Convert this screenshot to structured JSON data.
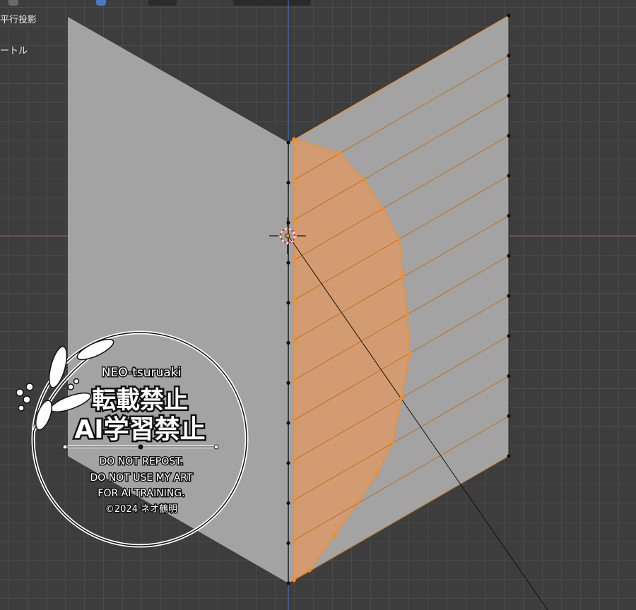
{
  "overlay": {
    "projection_label": "平行投影",
    "unit_label": "ートル"
  },
  "watermark": {
    "name": "NEO-tsuruaki",
    "line_jp_1": "転載禁止",
    "line_jp_2": "AI学習禁止",
    "line_en_1": "DO NOT REPOST.",
    "line_en_2": "DO NOT USE MY ART",
    "line_en_3": "FOR AI TRAINING.",
    "copyright": "©2024 ネオ鶴明"
  },
  "colors": {
    "grid_bg": "#3d3d3d",
    "grid_line": "#4a4a4a",
    "mesh_face": "#a3a3a3",
    "selected_face": "#d79a6c",
    "selected_edge": "#ff8a1c",
    "vertex": "#111111",
    "x_axis": "#b34a4a",
    "z_axis": "#3f6fb8"
  },
  "icons": {
    "cursor": "3d-cursor-icon",
    "watermark_leaf": "leaf-branch-icon"
  }
}
